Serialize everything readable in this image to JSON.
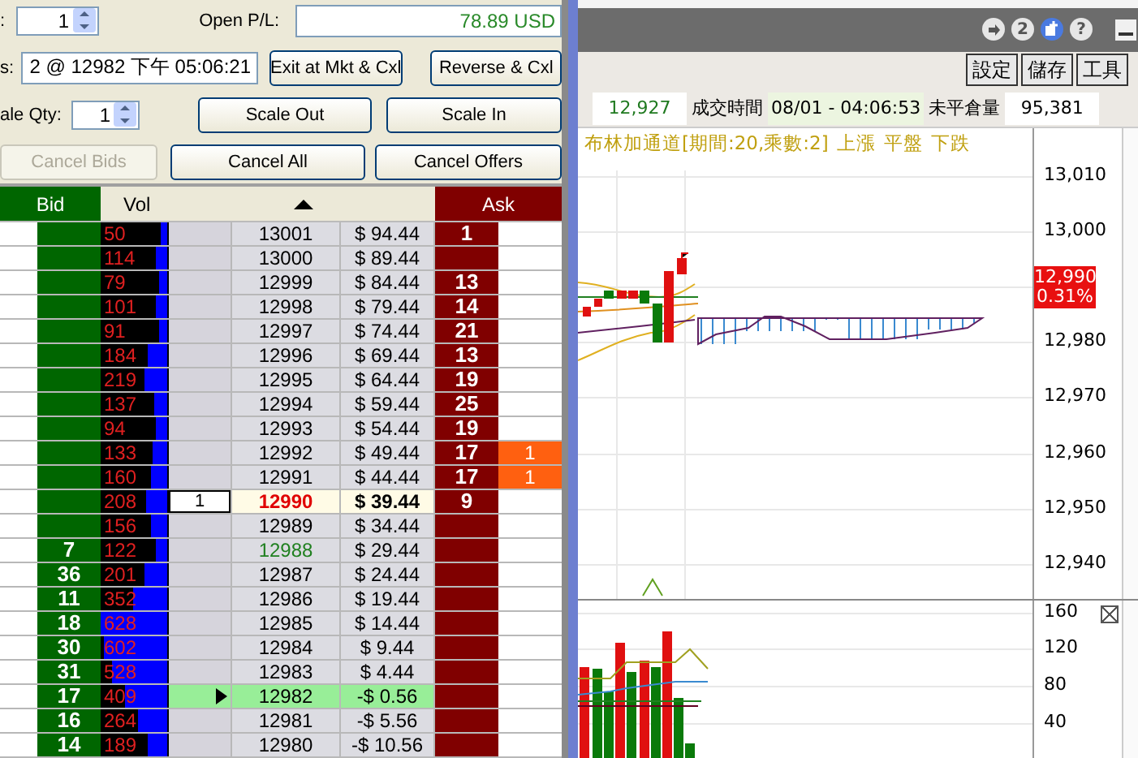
{
  "order_panel": {
    "quantity": {
      "label": ":",
      "value": "1"
    },
    "open_pl": {
      "label": "Open P/L:",
      "value": "78.89 USD"
    },
    "position": {
      "label": "s:",
      "value": "2 @ 12982 下午 05:06:21"
    },
    "scale_qty": {
      "label": "ale Qty:",
      "value": "1"
    },
    "buttons": [
      {
        "label": "Exit at Mkt & Cxl",
        "disabled": false,
        "kind": "exit"
      },
      {
        "label": "Reverse & Cxl",
        "disabled": false,
        "kind": "reverse"
      },
      {
        "label": "Scale Out",
        "disabled": false,
        "kind": "scale_out"
      },
      {
        "label": "Scale In",
        "disabled": false,
        "kind": "scale_in"
      },
      {
        "label": "Cancel Bids",
        "disabled": true,
        "kind": "cancel_bids"
      },
      {
        "label": "Cancel All",
        "disabled": false,
        "kind": "cancel_all"
      },
      {
        "label": "Cancel Offers",
        "disabled": false,
        "kind": "cancel_offers"
      }
    ]
  },
  "ladder": {
    "columns": {
      "bid": "Bid",
      "vol": "Vol",
      "ask": "Ask"
    },
    "rows": [
      {
        "vol": "50",
        "level": 0.09,
        "price": "13001",
        "pnl": "$ 94.44",
        "ask": "1",
        "kind": "normal"
      },
      {
        "vol": "114",
        "level": 0.18,
        "price": "13000",
        "pnl": "$ 89.44",
        "kind": "normal"
      },
      {
        "vol": "79",
        "level": 0.13,
        "price": "12999",
        "pnl": "$ 84.44",
        "ask": "13",
        "kind": "normal"
      },
      {
        "vol": "101",
        "level": 0.17,
        "price": "12998",
        "pnl": "$ 79.44",
        "ask": "14",
        "kind": "normal"
      },
      {
        "vol": "91",
        "level": 0.13,
        "price": "12997",
        "pnl": "$ 74.44",
        "ask": "21",
        "kind": "normal"
      },
      {
        "vol": "184",
        "level": 0.29,
        "price": "12996",
        "pnl": "$ 69.44",
        "ask": "13",
        "kind": "normal"
      },
      {
        "vol": "219",
        "level": 0.34,
        "price": "12995",
        "pnl": "$ 64.44",
        "ask": "19",
        "kind": "normal"
      },
      {
        "vol": "137",
        "level": 0.2,
        "price": "12994",
        "pnl": "$ 59.44",
        "ask": "25",
        "kind": "normal"
      },
      {
        "vol": "94",
        "level": 0.17,
        "price": "12993",
        "pnl": "$ 54.44",
        "ask": "19",
        "kind": "normal"
      },
      {
        "vol": "133",
        "level": 0.21,
        "price": "12992",
        "pnl": "$ 49.44",
        "ask": "17",
        "ask_order": "1",
        "kind": "normal"
      },
      {
        "vol": "160",
        "level": 0.25,
        "price": "12991",
        "pnl": "$ 44.44",
        "ask": "17",
        "ask_order": "1",
        "kind": "normal"
      },
      {
        "vol": "208",
        "level": 0.31,
        "order": "1",
        "price": "12990",
        "pnl": "$ 39.44",
        "ask": "9",
        "kind": "last"
      },
      {
        "vol": "156",
        "level": 0.25,
        "price": "12989",
        "pnl": "$ 34.44",
        "kind": "normal"
      },
      {
        "bid": "7",
        "vol": "122",
        "level": 0.18,
        "price": "12988",
        "pnl": "$ 29.44",
        "kind": "open"
      },
      {
        "bid": "36",
        "vol": "201",
        "level": 0.33,
        "price": "12987",
        "pnl": "$ 24.44",
        "kind": "normal"
      },
      {
        "bid": "11",
        "vol": "352",
        "level": 0.52,
        "price": "12986",
        "pnl": "$ 19.44",
        "kind": "normal"
      },
      {
        "bid": "18",
        "vol": "628",
        "level": 1,
        "price": "12985",
        "pnl": "$ 14.44",
        "kind": "normal"
      },
      {
        "bid": "30",
        "vol": "602",
        "level": 0.94,
        "price": "12984",
        "pnl": "$ 9.44",
        "kind": "normal"
      },
      {
        "bid": "31",
        "vol": "528",
        "level": 0.82,
        "price": "12983",
        "pnl": "$ 4.44",
        "kind": "normal"
      },
      {
        "bid": "17",
        "vol": "409",
        "level": 0.63,
        "price": "12982",
        "pnl": "-$ 0.56",
        "kind": "entry"
      },
      {
        "bid": "16",
        "vol": "264",
        "level": 0.44,
        "price": "12981",
        "pnl": "-$ 5.56",
        "kind": "normal"
      },
      {
        "bid": "14",
        "vol": "189",
        "level": 0.3,
        "price": "12980",
        "pnl": "-$ 10.56",
        "kind": "normal"
      }
    ]
  },
  "chart_window": {
    "title_buttons": [
      {
        "kind": "arrow"
      },
      {
        "kind": "glyph",
        "glyph": "2"
      },
      {
        "kind": "window"
      },
      {
        "kind": "glyph",
        "glyph": "?"
      }
    ],
    "toolbar": [
      "設定",
      "儲存",
      "工具"
    ],
    "info": [
      {
        "kind": "value",
        "text": "12,927",
        "color": "#207a20"
      },
      {
        "kind": "label",
        "text": "成交時間"
      },
      {
        "kind": "time",
        "text": "08/01  -  04:06:53"
      },
      {
        "kind": "label",
        "text": "未平倉量"
      },
      {
        "kind": "value",
        "text": "95,381",
        "color": "#000000"
      }
    ],
    "legend": [
      "布林加通道[期間:20,乘數:2]",
      "上漲",
      "平盤",
      "下跌"
    ],
    "price_axis": [
      "13,010",
      "13,000",
      "12,980",
      "12,970",
      "12,960",
      "12,950",
      "12,940"
    ],
    "last_price": {
      "price": "12,990",
      "change": "0.31%"
    },
    "volume_axis": [
      "160",
      "120",
      "80",
      "40"
    ]
  }
}
